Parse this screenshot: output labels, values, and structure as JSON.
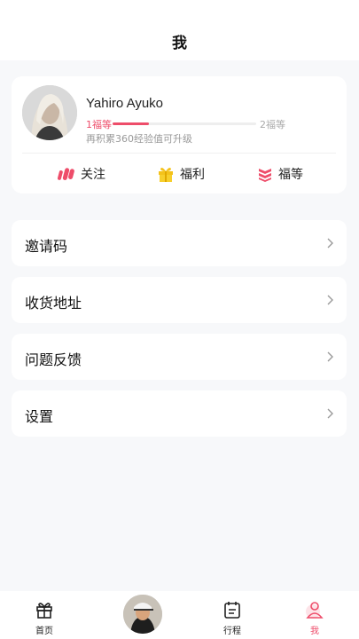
{
  "header": {
    "title": "我"
  },
  "profile": {
    "name": "Yahiro Ayuko",
    "level_current": "1福等",
    "level_next": "2福等",
    "level_progress": 0.25,
    "upgrade_hint": "再积累360经验值可升级"
  },
  "shortcuts": [
    {
      "label": "关注",
      "icon": "follow-icon"
    },
    {
      "label": "福利",
      "icon": "gift-icon"
    },
    {
      "label": "福等",
      "icon": "layers-icon"
    }
  ],
  "menu": [
    {
      "label": "邀请码"
    },
    {
      "label": "收货地址"
    },
    {
      "label": "问题反馈"
    },
    {
      "label": "设置"
    }
  ],
  "tabbar": {
    "items": [
      {
        "label": "首页",
        "icon": "gift-outline-icon"
      },
      {
        "label": "",
        "icon": "center-avatar"
      },
      {
        "label": "行程",
        "icon": "calendar-icon"
      },
      {
        "label": "我",
        "icon": "user-icon"
      }
    ],
    "active": "我"
  },
  "colors": {
    "accent": "#ee4d6a",
    "background": "#f7f8fa",
    "gift": "#f4c21b"
  }
}
